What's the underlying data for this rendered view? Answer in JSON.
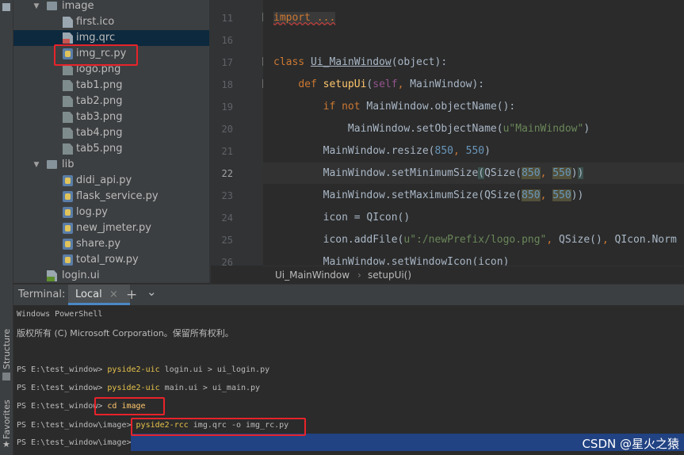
{
  "toolstrip": {
    "structure_label": "Structure",
    "favorites_label": "Favorites"
  },
  "tree": {
    "items": [
      {
        "label": "image",
        "icon": "folder-icon",
        "expanded": true
      },
      {
        "label": "first.ico",
        "icon": "file-icon"
      },
      {
        "label": "img.qrc",
        "icon": "qrc-file-icon",
        "selected": true
      },
      {
        "label": "img_rc.py",
        "icon": "python-file-icon"
      },
      {
        "label": "logo.png",
        "icon": "image-file-icon"
      },
      {
        "label": "tab1.png",
        "icon": "image-file-icon"
      },
      {
        "label": "tab2.png",
        "icon": "image-file-icon"
      },
      {
        "label": "tab3.png",
        "icon": "image-file-icon"
      },
      {
        "label": "tab4.png",
        "icon": "image-file-icon"
      },
      {
        "label": "tab5.png",
        "icon": "image-file-icon"
      },
      {
        "label": "lib",
        "icon": "folder-icon",
        "expanded": true
      },
      {
        "label": "didi_api.py",
        "icon": "python-file-icon"
      },
      {
        "label": "flask_service.py",
        "icon": "python-file-icon"
      },
      {
        "label": "log.py",
        "icon": "python-file-icon"
      },
      {
        "label": "new_jmeter.py",
        "icon": "python-file-icon"
      },
      {
        "label": "share.py",
        "icon": "python-file-icon"
      },
      {
        "label": "total_row.py",
        "icon": "python-file-icon"
      },
      {
        "label": "login.ui",
        "icon": "ui-file-icon"
      }
    ]
  },
  "editor": {
    "line_numbers": [
      "11",
      "16",
      "17",
      "18",
      "19",
      "20",
      "21",
      "22",
      "23",
      "24",
      "25",
      "26"
    ],
    "lines": [
      "import ...",
      "",
      "class Ui_MainWindow(object):",
      "    def setupUi(self, MainWindow):",
      "        if not MainWindow.objectName():",
      "            MainWindow.setObjectName(u\"MainWindow\")",
      "        MainWindow.resize(850, 550)",
      "        MainWindow.setMinimumSize(QSize(850, 550))",
      "        MainWindow.setMaximumSize(QSize(850, 550))",
      "        icon = QIcon()",
      "        icon.addFile(u\":/newPrefix/logo.png\", QSize(), QIcon.Norm",
      "        MainWindow.setWindowIcon(icon)"
    ],
    "breadcrumbs": [
      "Ui_MainWindow",
      "setupUi()"
    ]
  },
  "terminal": {
    "label": "Terminal:",
    "tab_local": "Local",
    "close_symbol": "×",
    "add_symbol": "+",
    "dropdown_symbol": "⌄",
    "lines": {
      "l1": "Windows PowerShell",
      "l2": "版权所有 (C) Microsoft Corporation。保留所有权利。",
      "p1": "PS E:\\test_window>",
      "c1a": "pyside2-uic",
      "c1b": " login.ui > ui_login.py",
      "p2": "PS E:\\test_window>",
      "c2a": "pyside2-uic",
      "c2b": " main.ui > ui_main.py",
      "p3": "PS E:\\test_window>",
      "c3": "cd image",
      "p4": "PS E:\\test_window\\image>",
      "c4a": "pyside2-rcc",
      "c4b": " img.qrc -o img_rc.py",
      "p5": "PS E:\\test_window\\image>"
    }
  },
  "watermark": "CSDN @星火之猿",
  "colors": {
    "highlight_box": "#e8232a",
    "selection": "#214283",
    "tree_selection": "#0d293e"
  }
}
